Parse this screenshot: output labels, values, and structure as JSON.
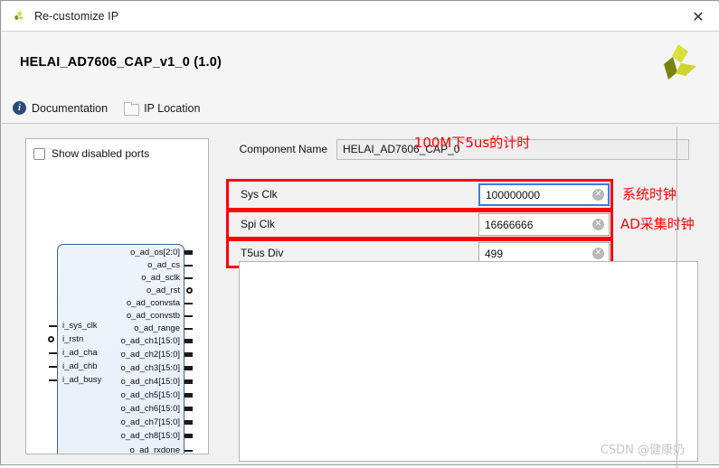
{
  "window": {
    "title": "Re-customize IP",
    "close_label": "✕",
    "app_icon": "xilinx-logo-icon"
  },
  "header": {
    "ip_title": "HELAI_AD7606_CAP_v1_0 (1.0)",
    "logo": "xilinx-tri-blade-logo"
  },
  "links": [
    {
      "label": "Documentation",
      "icon": "info-icon"
    },
    {
      "label": "IP Location",
      "icon": "folder-icon"
    }
  ],
  "ports_panel": {
    "show_disabled_ports": {
      "label": "Show disabled ports",
      "checked": false
    },
    "input_ports": [
      "i_sys_clk",
      "i_rstn",
      "i_ad_cha",
      "i_ad_chb",
      "i_ad_busy"
    ],
    "output_ports": [
      "o_ad_os[2:0]",
      "o_ad_cs",
      "o_ad_sclk",
      "o_ad_rst",
      "o_ad_convsta",
      "o_ad_convstb",
      "o_ad_range",
      "o_ad_ch1[15:0]",
      "o_ad_ch2[15:0]",
      "o_ad_ch3[15:0]",
      "o_ad_ch4[15:0]",
      "o_ad_ch5[15:0]",
      "o_ad_ch6[15:0]",
      "o_ad_ch7[15:0]",
      "o_ad_ch8[15:0]",
      "o_ad_rxdone"
    ]
  },
  "config": {
    "component_name": {
      "label": "Component Name",
      "value": "HELAI_AD7606_CAP_0"
    },
    "parameters": [
      {
        "label": "Sys Clk",
        "value": "100000000",
        "focused": true,
        "clear_glyph": "✕"
      },
      {
        "label": "Spi Clk",
        "value": "16666666",
        "focused": false,
        "clear_glyph": "✕"
      },
      {
        "label": "T5us Div",
        "value": "499",
        "focused": false,
        "clear_glyph": "✕"
      }
    ]
  },
  "annotations": {
    "sys_clk_note": "系统时钟",
    "spi_clk_note": "AD采集时钟",
    "t5us_note": "100M下5us的计时",
    "highlight_color": "#ff0000"
  },
  "watermark": {
    "text": "CSDN @健康奶"
  }
}
